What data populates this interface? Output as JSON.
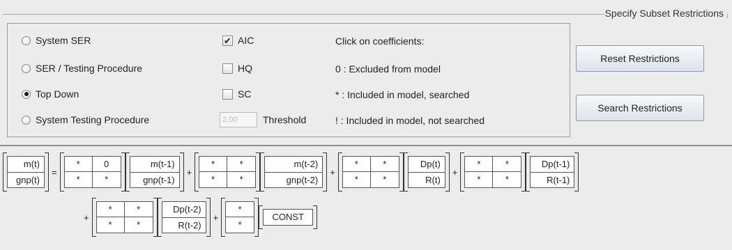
{
  "group": {
    "title": "Specify Subset Restrictions"
  },
  "strategies": [
    {
      "label": "System SER",
      "selected": false
    },
    {
      "label": "SER / Testing Procedure",
      "selected": false
    },
    {
      "label": "Top Down",
      "selected": true
    },
    {
      "label": "System Testing Procedure",
      "selected": false
    }
  ],
  "criteria": [
    {
      "label": "AIC",
      "checked": true
    },
    {
      "label": "HQ",
      "checked": false
    },
    {
      "label": "SC",
      "checked": false
    }
  ],
  "threshold": {
    "value": "2.00",
    "label": "Threshold"
  },
  "legend": {
    "header": "Click on coefficients:",
    "items": [
      "0 :  Excluded from model",
      "* :  Included in model, searched",
      "! :  Included in model, not searched"
    ]
  },
  "buttons": {
    "reset": "Reset Restrictions",
    "search": "Search Restrictions"
  },
  "equation": {
    "lhs": [
      "m(t)",
      "gnp(t)"
    ],
    "equals": "=",
    "plus": "+",
    "coef_matrices": [
      [
        [
          "*",
          "0"
        ],
        [
          "*",
          "*"
        ]
      ],
      [
        [
          "*",
          "*"
        ],
        [
          "*",
          "*"
        ]
      ],
      [
        [
          "*",
          "*"
        ],
        [
          "*",
          "*"
        ]
      ],
      [
        [
          "*",
          "*"
        ],
        [
          "*",
          "*"
        ]
      ],
      [
        [
          "*",
          "*"
        ],
        [
          "*",
          "*"
        ]
      ],
      [
        [
          "*"
        ],
        [
          "*"
        ]
      ]
    ],
    "regressors": [
      [
        "m(t-1)",
        "gnp(t-1)"
      ],
      [
        "m(t-2)",
        "gnp(t-2)"
      ],
      [
        "Dp(t)",
        "R(t)"
      ],
      [
        "Dp(t-1)",
        "R(t-1)"
      ],
      [
        "Dp(t-2)",
        "R(t-2)"
      ],
      [
        "CONST"
      ]
    ]
  }
}
